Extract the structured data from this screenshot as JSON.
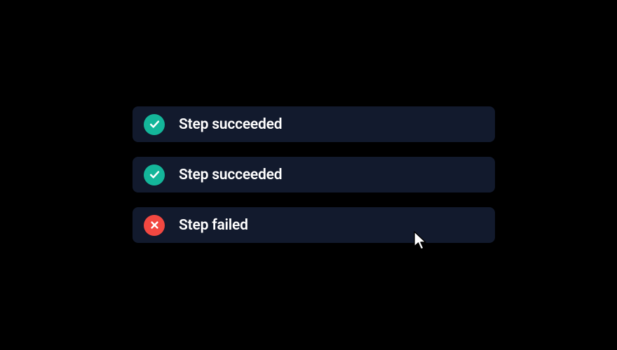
{
  "steps": [
    {
      "status": "success",
      "label": "Step succeeded"
    },
    {
      "status": "success",
      "label": "Step succeeded"
    },
    {
      "status": "failure",
      "label": "Step failed"
    }
  ],
  "colors": {
    "success": "#14b69a",
    "failure": "#f24841",
    "panel": "#121a2d",
    "text": "#ffffff",
    "background": "#000000"
  }
}
